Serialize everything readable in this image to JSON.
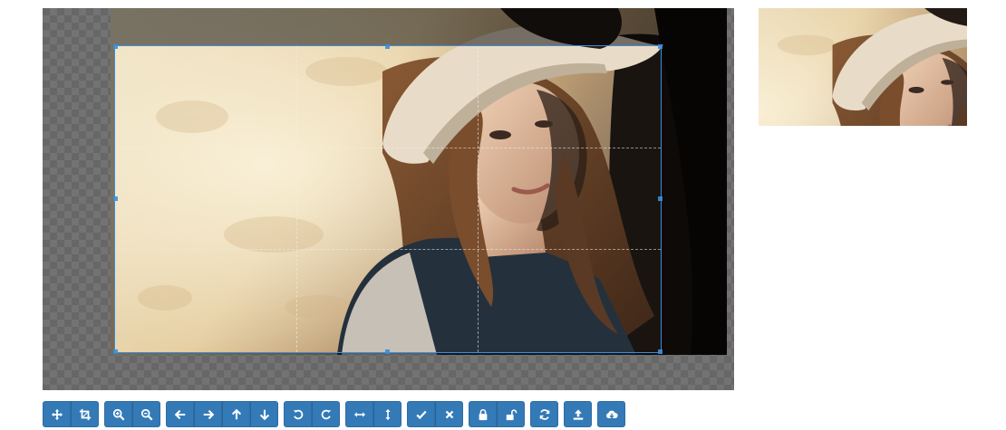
{
  "editor": {
    "image_description": "portrait-photo",
    "accent_color": "#3c8dde",
    "button_color": "#337ab7"
  },
  "toolbar": {
    "groups": [
      {
        "name": "drag-mode",
        "buttons": [
          {
            "icon": "move-icon"
          },
          {
            "icon": "crop-icon"
          }
        ]
      },
      {
        "name": "zoom",
        "buttons": [
          {
            "icon": "zoom-in-icon"
          },
          {
            "icon": "zoom-out-icon"
          }
        ]
      },
      {
        "name": "move",
        "buttons": [
          {
            "icon": "arrow-left-icon"
          },
          {
            "icon": "arrow-right-icon"
          },
          {
            "icon": "arrow-up-icon"
          },
          {
            "icon": "arrow-down-icon"
          }
        ]
      },
      {
        "name": "rotate",
        "buttons": [
          {
            "icon": "rotate-left-icon"
          },
          {
            "icon": "rotate-right-icon"
          }
        ]
      },
      {
        "name": "flip",
        "buttons": [
          {
            "icon": "flip-horizontal-icon"
          },
          {
            "icon": "flip-vertical-icon"
          }
        ]
      },
      {
        "name": "crop-actions",
        "buttons": [
          {
            "icon": "check-icon"
          },
          {
            "icon": "close-icon"
          }
        ]
      },
      {
        "name": "lock",
        "buttons": [
          {
            "icon": "lock-icon"
          },
          {
            "icon": "unlock-icon"
          }
        ]
      },
      {
        "name": "reset",
        "buttons": [
          {
            "icon": "refresh-icon"
          }
        ]
      },
      {
        "name": "upload",
        "buttons": [
          {
            "icon": "upload-icon"
          }
        ]
      },
      {
        "name": "download",
        "buttons": [
          {
            "icon": "cloud-download-icon"
          }
        ]
      }
    ]
  }
}
